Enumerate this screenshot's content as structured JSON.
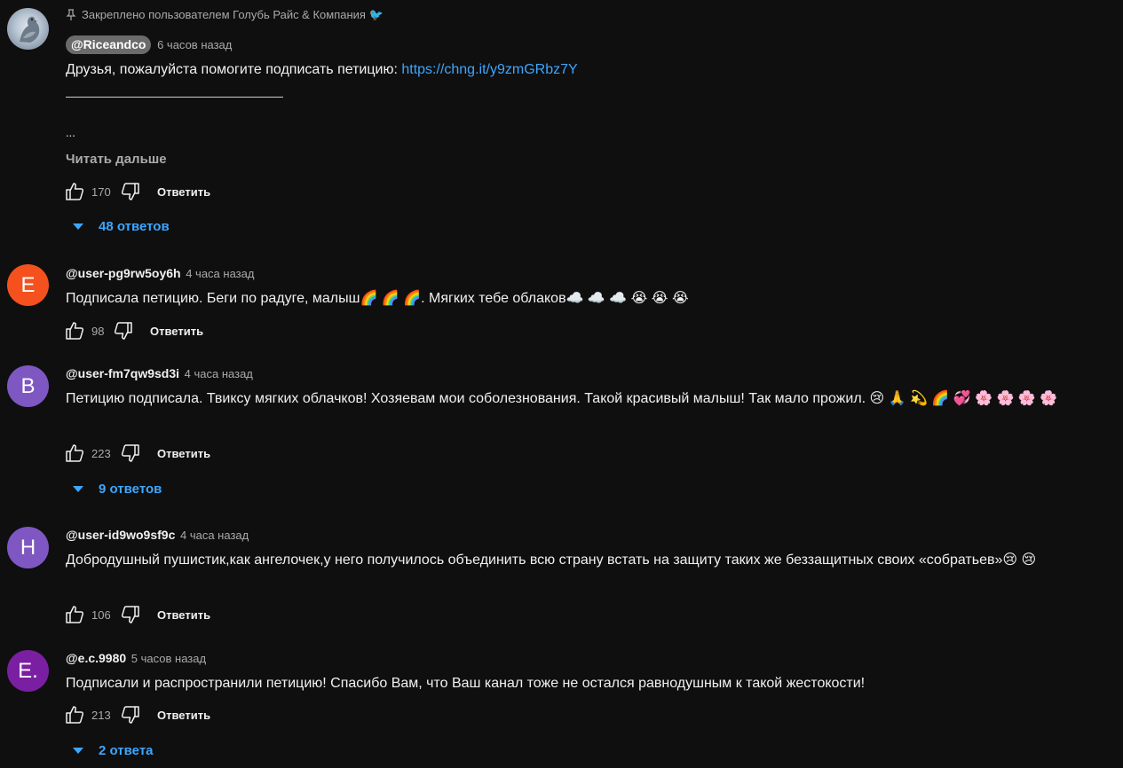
{
  "pinned_comment": {
    "pinned_label": "Закреплено пользователем Голубь Райс & Компания 🐦",
    "author": "@Riceandco",
    "time": "6 часов назад",
    "text": "Друзья, пожалуйста помогите подписать  петицию: ",
    "link": "https://chng.it/y9zmGRbz7Y",
    "ellipsis": "...",
    "read_more": "Читать дальше",
    "likes": "170",
    "reply_label": "Ответить",
    "replies_label": "48 ответов"
  },
  "comments": [
    {
      "avatar_letter": "E",
      "avatar_color": "#f4511e",
      "author": "@user-pg9rw5oy6h",
      "time": "4 часа назад",
      "text": "Подписала петицию. Беги по радуге, малыш🌈 🌈 🌈. Мягких тебе облаков☁️ ☁️ ☁️  😭 😭 😭",
      "likes": "98",
      "reply_label": "Ответить"
    },
    {
      "avatar_letter": "B",
      "avatar_color": "#7e57c2",
      "author": "@user-fm7qw9sd3i",
      "time": "4 часа назад",
      "text": "Петицию подписала. Твиксу мягких облачков! Хозяевам мои соболезнования. Такой красивый малыш! Так мало прожил. 😢 🙏 💫 🌈 💞 🌸 🌸 🌸 🌸",
      "likes": "223",
      "reply_label": "Ответить",
      "replies_label": "9 ответов"
    },
    {
      "avatar_letter": "H",
      "avatar_color": "#7e57c2",
      "author": "@user-id9wo9sf9c",
      "time": "4 часа назад",
      "text": "Добродушный пушистик,как ангелочек,у него получилось объединить всю страну встать на защиту таких же беззащитных своих «собратьев»😢 😢",
      "likes": "106",
      "reply_label": "Ответить"
    },
    {
      "avatar_letter": "E.",
      "avatar_color": "#7b1fa2",
      "author": "@e.c.9980",
      "time": "5 часов назад",
      "text": "Подписали и распространили петицию! Спасибо Вам, что Ваш канал тоже не остался равнодушным к такой жестокости!",
      "likes": "213",
      "reply_label": "Ответить",
      "replies_label": "2 ответа"
    }
  ]
}
